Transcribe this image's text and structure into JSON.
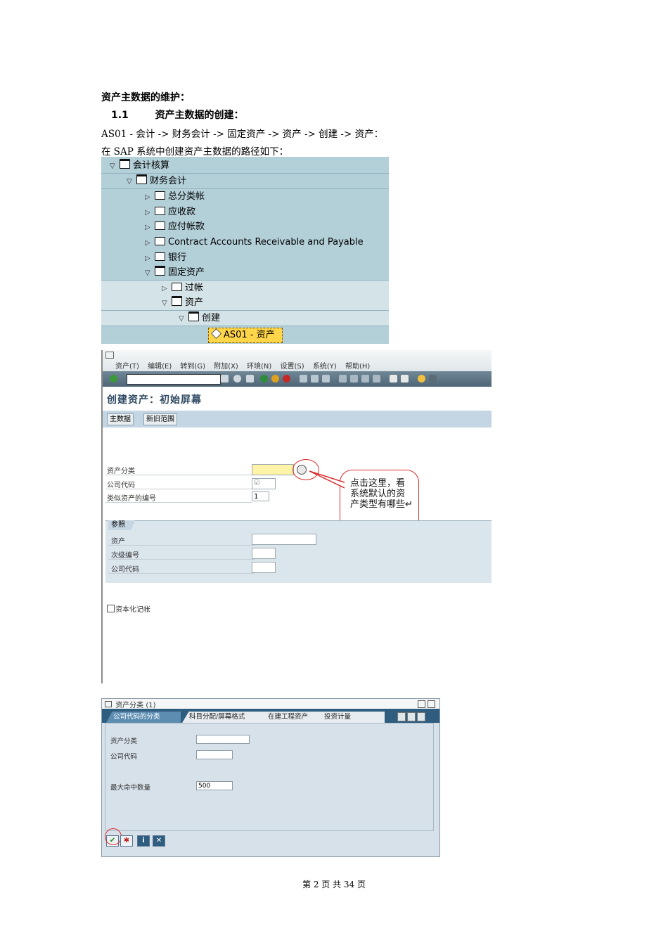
{
  "doc": {
    "heading": "资产主数据的维护：",
    "section_number": "1.1",
    "section_title": "资产主数据的创建：",
    "path_line": "AS01 - 会计 -> 财务会计 -> 固定资产 -> 资产 -> 创建 -> 资产：",
    "intro_line": "在 SAP 系统中创建资产主数据的路径如下："
  },
  "tree": {
    "items": [
      {
        "label": "会计核算",
        "expand": "▽"
      },
      {
        "label": "财务会计",
        "expand": "▽"
      },
      {
        "label": "总分类帐",
        "expand": "▷"
      },
      {
        "label": "应收款",
        "expand": "▷"
      },
      {
        "label": "应付帐款",
        "expand": "▷"
      },
      {
        "label": "Contract Accounts Receivable and Payable",
        "expand": "▷"
      },
      {
        "label": "银行",
        "expand": "▷"
      },
      {
        "label": "固定资产",
        "expand": "▽"
      },
      {
        "label": "过帐",
        "expand": "▷"
      },
      {
        "label": "资产",
        "expand": "▽"
      },
      {
        "label": "创建",
        "expand": "▽"
      }
    ],
    "selected": "AS01 - 资产"
  },
  "sap_screen": {
    "menu": [
      "资产(T)",
      "编辑(E)",
      "转到(G)",
      "附加(X)",
      "环境(N)",
      "设置(S)",
      "系统(Y)",
      "帮助(H)"
    ],
    "title": "创建资产：初始屏幕",
    "buttons": [
      "主数据",
      "新旧范围"
    ],
    "fields": {
      "asset_class": "资产分类",
      "company_code": "公司代码",
      "similar_count": "类似资产的编号",
      "similar_count_value": "1"
    },
    "reference": {
      "tab": "参照",
      "asset": "资产",
      "sub_number": "次级编号",
      "company_code": "公司代码"
    },
    "checkbox": "资本化记帐",
    "callout": "点击这里，看系统默认的资产类型有哪些↵"
  },
  "dialog": {
    "title": "资产分类 (1)",
    "tabs": [
      "公司代码的分类",
      "科目分配/屏幕格式",
      "在建工程资产",
      "投资计量"
    ],
    "fields": {
      "asset_class": "资产分类",
      "company_code": "公司代码",
      "max_hits": "最大命中数量",
      "max_hits_value": "500"
    }
  },
  "footer": "第 2 页 共 34 页"
}
